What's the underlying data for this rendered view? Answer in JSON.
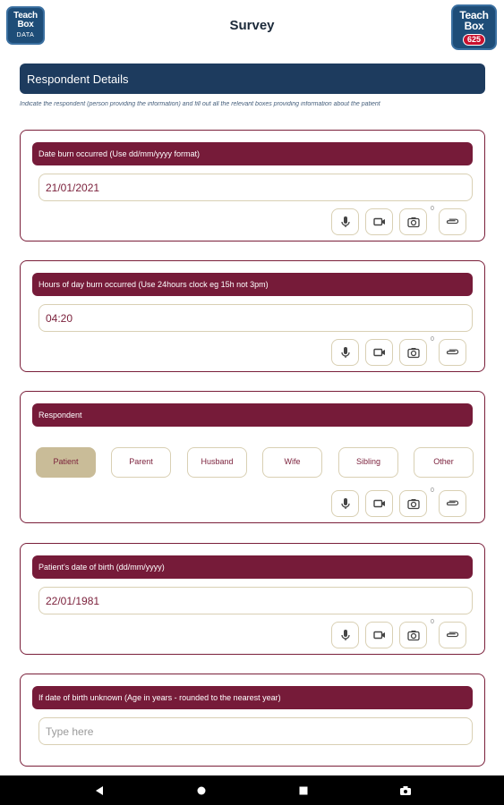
{
  "header": {
    "title": "Survey",
    "logo_left": {
      "line1": "Teach",
      "line2": "Box",
      "line3": "DATA"
    },
    "logo_right": {
      "line1": "Teach",
      "line2": "Box",
      "badge": "625"
    }
  },
  "section": {
    "title": "Respondent Details",
    "description": "Indicate the respondent (person providing the information) and fill out all the relevant boxes providing information about the patient"
  },
  "questions": [
    {
      "label": "Date burn occurred (Use dd/mm/yyyy format)",
      "value": "21/01/2021",
      "attachment_count": "0"
    },
    {
      "label": "Hours of day burn occurred (Use 24hours clock eg 15h not 3pm)",
      "value": "04:20",
      "attachment_count": "0"
    },
    {
      "label": "Respondent",
      "options": [
        "Patient",
        "Parent",
        "Husband",
        "Wife",
        "Sibling",
        "Other"
      ],
      "selected": "Patient",
      "attachment_count": "0"
    },
    {
      "label": "Patient's date of birth (dd/mm/yyyy)",
      "value": "22/01/1981",
      "attachment_count": "0"
    },
    {
      "label": "If date of birth unknown (Age in years - rounded to the nearest year)",
      "placeholder": "Type here"
    }
  ],
  "tools": [
    "microphone-icon",
    "video-camera-icon",
    "camera-icon",
    "attachment-icon"
  ],
  "colors": {
    "header_bar": "#1d3b5e",
    "question_bar": "#761b39",
    "selected_option": "#c9bc98",
    "input_border": "#d9d0b4"
  },
  "navbar": [
    "back",
    "home",
    "recents",
    "screenshot"
  ]
}
